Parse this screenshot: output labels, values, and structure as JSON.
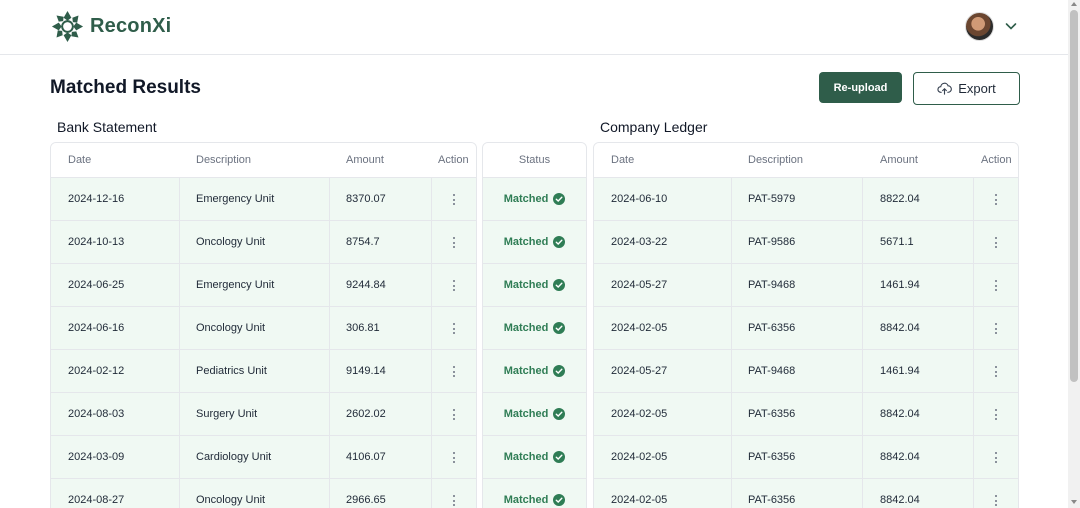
{
  "app": {
    "name": "ReconXi"
  },
  "page": {
    "title": "Matched Results"
  },
  "actions": {
    "reupload_label": "Re-upload",
    "export_label": "Export"
  },
  "colors": {
    "brand": "#2f5d4a",
    "row_bg": "#f0f9f3",
    "matched": "#2f7d55"
  },
  "icons": [
    "logo-mark-icon",
    "avatar",
    "chevron-down-icon",
    "cloud-upload-icon",
    "more-vertical-icon",
    "check-circle-icon"
  ],
  "bank": {
    "title": "Bank Statement",
    "columns": [
      "Date",
      "Description",
      "Amount",
      "Action"
    ],
    "rows": [
      {
        "date": "2024-12-16",
        "description": "Emergency Unit",
        "amount": "8370.07"
      },
      {
        "date": "2024-10-13",
        "description": "Oncology Unit",
        "amount": "8754.7"
      },
      {
        "date": "2024-06-25",
        "description": "Emergency Unit",
        "amount": "9244.84"
      },
      {
        "date": "2024-06-16",
        "description": "Oncology Unit",
        "amount": "306.81"
      },
      {
        "date": "2024-02-12",
        "description": "Pediatrics Unit",
        "amount": "9149.14"
      },
      {
        "date": "2024-08-03",
        "description": "Surgery Unit",
        "amount": "2602.02"
      },
      {
        "date": "2024-03-09",
        "description": "Cardiology Unit",
        "amount": "4106.07"
      },
      {
        "date": "2024-08-27",
        "description": "Oncology Unit",
        "amount": "2966.65"
      }
    ]
  },
  "status": {
    "column": "Status",
    "rows": [
      "Matched",
      "Matched",
      "Matched",
      "Matched",
      "Matched",
      "Matched",
      "Matched",
      "Matched"
    ]
  },
  "ledger": {
    "title": "Company Ledger",
    "columns": [
      "Date",
      "Description",
      "Amount",
      "Action"
    ],
    "rows": [
      {
        "date": "2024-06-10",
        "description": "PAT-5979",
        "amount": "8822.04"
      },
      {
        "date": "2024-03-22",
        "description": "PAT-9586",
        "amount": "5671.1"
      },
      {
        "date": "2024-05-27",
        "description": "PAT-9468",
        "amount": "1461.94"
      },
      {
        "date": "2024-02-05",
        "description": "PAT-6356",
        "amount": "8842.04"
      },
      {
        "date": "2024-05-27",
        "description": "PAT-9468",
        "amount": "1461.94"
      },
      {
        "date": "2024-02-05",
        "description": "PAT-6356",
        "amount": "8842.04"
      },
      {
        "date": "2024-02-05",
        "description": "PAT-6356",
        "amount": "8842.04"
      },
      {
        "date": "2024-02-05",
        "description": "PAT-6356",
        "amount": "8842.04"
      }
    ]
  }
}
